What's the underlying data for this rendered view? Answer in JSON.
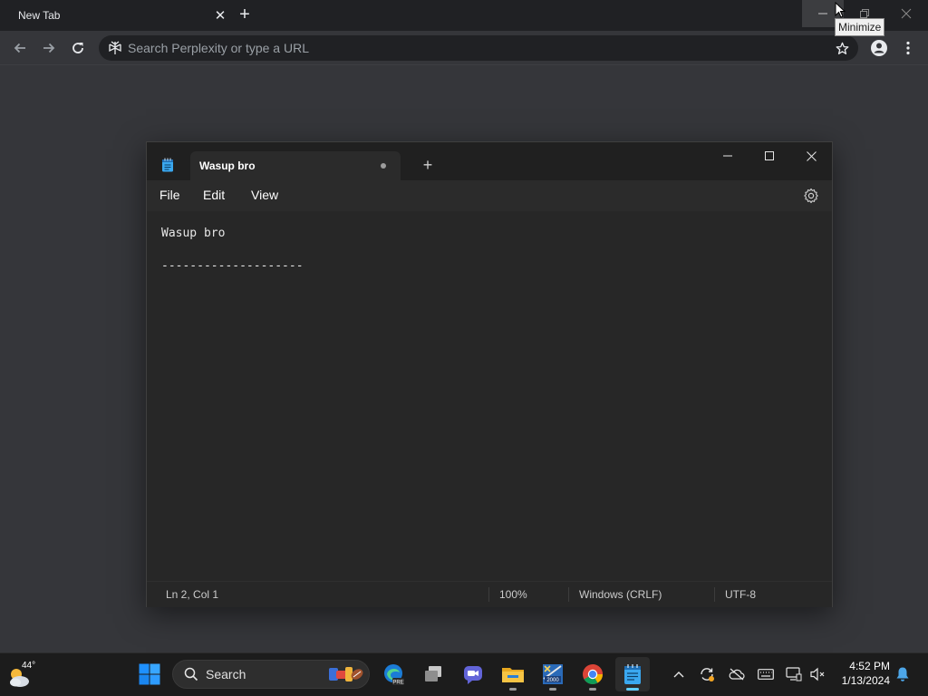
{
  "browser": {
    "tab_title": "New Tab",
    "close_symbol": "✕",
    "newtab_symbol": "+",
    "tooltip": "Minimize",
    "omnibox_placeholder": "Search Perplexity or type a URL",
    "icons": [
      "back-icon",
      "forward-icon",
      "reload-icon",
      "perplexity-icon",
      "star-icon",
      "profile-icon",
      "menu-icon"
    ]
  },
  "notepad": {
    "tab_title": "Wasup bro",
    "newtab_symbol": "+",
    "menus": [
      "File",
      "Edit",
      "View"
    ],
    "lines": [
      "Wasup bro",
      "--------------------"
    ],
    "status": {
      "position": "Ln 2, Col 1",
      "zoom": "100%",
      "line_ending": "Windows (CRLF)",
      "encoding": "UTF-8"
    }
  },
  "taskbar": {
    "weather_temp": "44°",
    "search_label": "Search",
    "time": "4:52 PM",
    "date": "1/13/2024",
    "accent": "#60cdff"
  }
}
